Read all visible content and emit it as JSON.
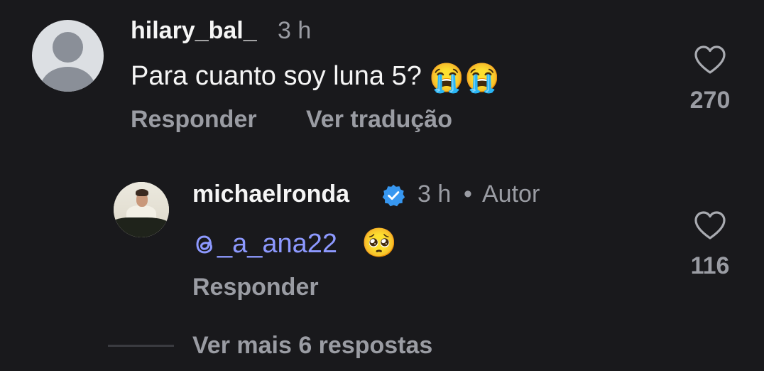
{
  "comment": {
    "username": "hilary_bal_",
    "time": "3 h",
    "text": "Para cuanto soy luna 5?",
    "emojis": [
      "😭",
      "😭"
    ],
    "reply_label": "Responder",
    "translate_label": "Ver tradução",
    "likes": "270"
  },
  "reply": {
    "username": "michaelronda",
    "verified": true,
    "time": "3 h",
    "separator": "•",
    "author_label": "Autor",
    "mention": "_a_ana22",
    "emoji": "🥺",
    "reply_label": "Responder",
    "likes": "116"
  },
  "view_more": {
    "label": "Ver mais 6 respostas"
  },
  "colors": {
    "background": "#19191c",
    "primary_text": "#f5f5f5",
    "secondary_text": "#9a9ca3",
    "mention": "#8d99ff",
    "verified": "#3797f0"
  },
  "icons": {
    "like": "heart-icon",
    "verified": "verified-badge-icon",
    "mention": "threads-icon",
    "default_avatar": "default-avatar-icon"
  }
}
